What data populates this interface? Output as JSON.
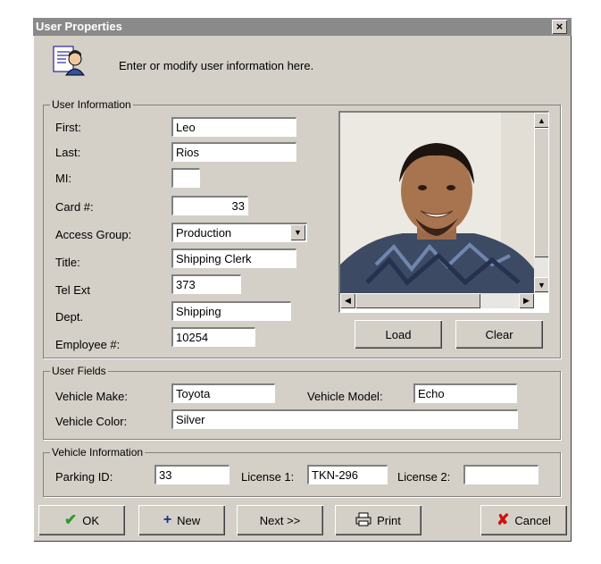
{
  "window": {
    "title": "User Properties",
    "close_glyph": "×"
  },
  "header": {
    "instruction": "Enter or modify user information here.",
    "icon": "user-document-icon"
  },
  "user_information": {
    "group_label": "User Information",
    "first": {
      "label": "First:",
      "value": "Leo"
    },
    "last": {
      "label": "Last:",
      "value": "Rios"
    },
    "mi": {
      "label": "MI:",
      "value": ""
    },
    "card": {
      "label": "Card #:",
      "value": "33"
    },
    "access_group": {
      "label": "Access Group:",
      "value": "Production"
    },
    "title": {
      "label": "Title:",
      "value": "Shipping Clerk"
    },
    "tel_ext": {
      "label": "Tel Ext",
      "value": "373"
    },
    "dept": {
      "label": "Dept.",
      "value": "Shipping"
    },
    "employee": {
      "label": "Employee #:",
      "value": "10254"
    }
  },
  "photo": {
    "load_label": "Load",
    "clear_label": "Clear"
  },
  "user_fields": {
    "group_label": "User Fields",
    "vehicle_make": {
      "label": "Vehicle Make:",
      "value": "Toyota"
    },
    "vehicle_model": {
      "label": "Vehicle Model:",
      "value": "Echo"
    },
    "vehicle_color": {
      "label": "Vehicle Color:",
      "value": "Silver"
    }
  },
  "vehicle_information": {
    "group_label": "Vehicle Information",
    "parking_id": {
      "label": "Parking ID:",
      "value": "33"
    },
    "license1": {
      "label": "License 1:",
      "value": "TKN-296"
    },
    "license2": {
      "label": "License 2:",
      "value": ""
    }
  },
  "buttons": {
    "ok": "OK",
    "new": "New",
    "next": "Next >>",
    "print": "Print",
    "cancel": "Cancel"
  },
  "colors": {
    "dialog_bg": "#d4d0c8",
    "titlebar": "#8a8a8a",
    "ok_check": "#2e9a2e",
    "new_plus": "#1a2f8a",
    "cancel_x": "#cc1111"
  }
}
